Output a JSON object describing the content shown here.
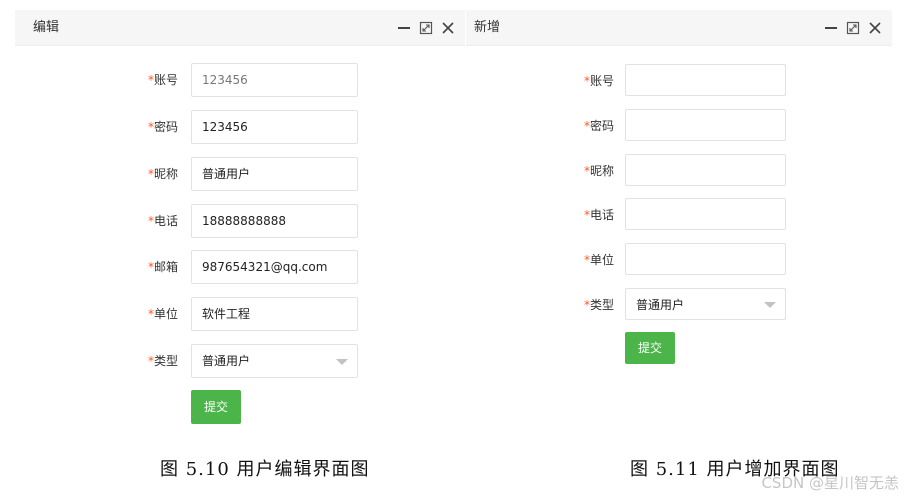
{
  "edit_dialog": {
    "title": "编辑",
    "fields": [
      {
        "required": "*",
        "label": "账号",
        "value": "123456"
      },
      {
        "required": "*",
        "label": "密码",
        "value": "123456"
      },
      {
        "required": "*",
        "label": "昵称",
        "value": "普通用户"
      },
      {
        "required": "*",
        "label": "电话",
        "value": "18888888888"
      },
      {
        "required": "*",
        "label": "邮箱",
        "value": "987654321@qq.com"
      },
      {
        "required": "*",
        "label": "单位",
        "value": "软件工程"
      },
      {
        "required": "*",
        "label": "类型",
        "value": "普通用户"
      }
    ],
    "submit_label": "提交"
  },
  "add_dialog": {
    "title": "新增",
    "fields": [
      {
        "required": "*",
        "label": "账号",
        "value": ""
      },
      {
        "required": "*",
        "label": "密码",
        "value": ""
      },
      {
        "required": "*",
        "label": "昵称",
        "value": ""
      },
      {
        "required": "*",
        "label": "电话",
        "value": ""
      },
      {
        "required": "*",
        "label": "单位",
        "value": ""
      },
      {
        "required": "*",
        "label": "类型",
        "value": "普通用户"
      }
    ],
    "submit_label": "提交"
  },
  "window_controls": [
    "minimize-icon",
    "maximize-icon",
    "close-icon"
  ],
  "captions": {
    "left": "图 5.10  用户编辑界面图",
    "right": "图 5.11  用户增加界面图"
  },
  "watermark": "CSDN @星川智无恙",
  "colors": {
    "accent": "#4cb54a",
    "required_star": "#ff5722",
    "titlebar_bg": "#f6f6f6"
  }
}
